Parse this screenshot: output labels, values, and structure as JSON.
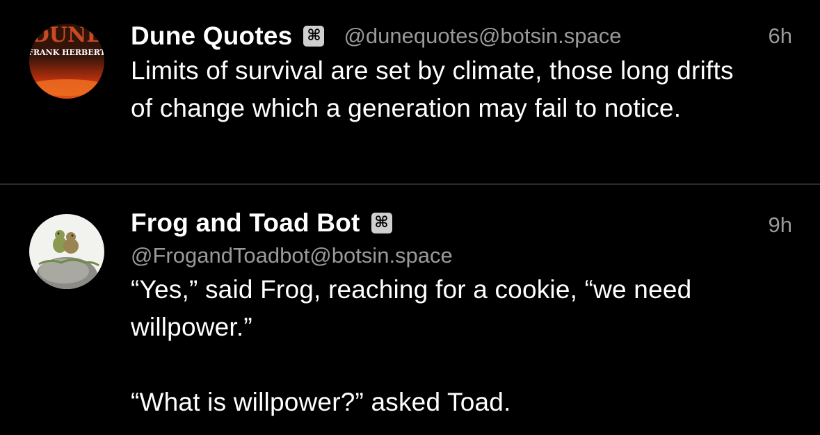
{
  "posts": [
    {
      "display_name": "Dune Quotes",
      "badge_glyph": "⌘",
      "handle": "@dunequotes@botsin.space",
      "time": "6h",
      "avatar": {
        "icon": "dune-book-cover-avatar",
        "title_text": "DUNE",
        "author_text": "FRANK HERBERT"
      },
      "paragraphs": [
        "Limits of survival are set by climate, those long drifts of change which a generation may fail to notice."
      ]
    },
    {
      "display_name": "Frog and Toad Bot",
      "badge_glyph": "⌘",
      "handle": "@FrogandToadbot@botsin.space",
      "time": "9h",
      "avatar": {
        "icon": "frog-and-toad-avatar"
      },
      "paragraphs": [
        "“Yes,” said Frog, reaching for a cookie, “we need willpower.”",
        "“What is willpower?” asked Toad."
      ]
    }
  ],
  "colors": {
    "background": "#000000",
    "text": "#ffffff",
    "secondary": "#9a9a9a",
    "divider": "#2a2a2a",
    "badge": "#cfcfcf"
  }
}
